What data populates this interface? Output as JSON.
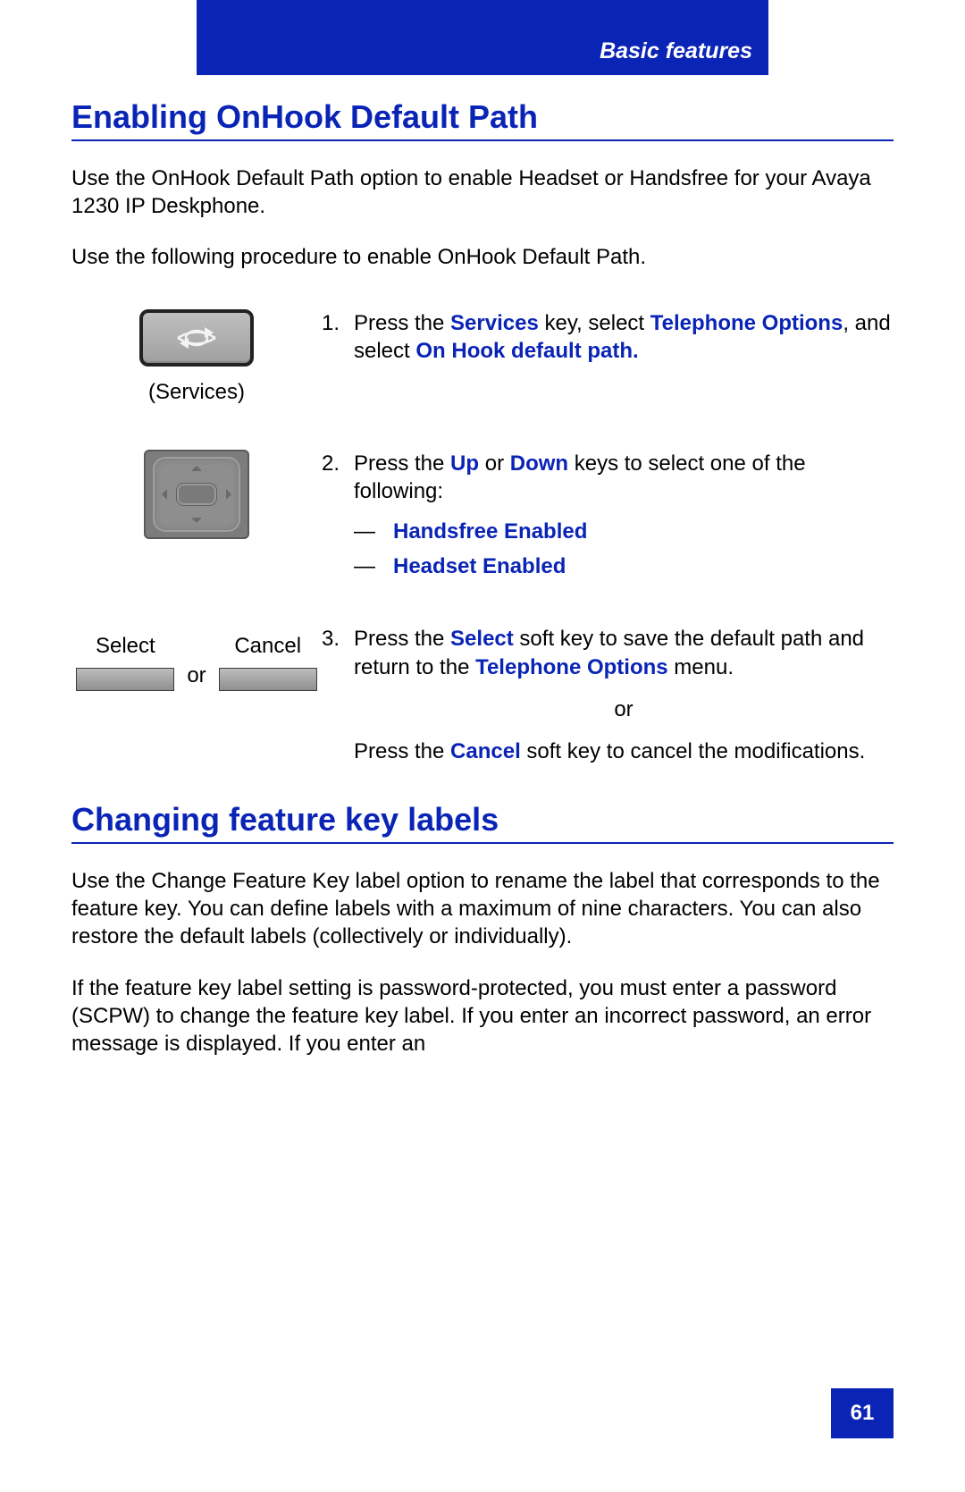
{
  "header": {
    "section_label": "Basic features"
  },
  "section1": {
    "title": "Enabling OnHook Default Path",
    "intro1": "Use the OnHook Default Path option to enable Headset or Handsfree for your Avaya 1230 IP Deskphone.",
    "intro2": "Use the following procedure to enable OnHook Default Path."
  },
  "steps": {
    "s1": {
      "num": "1.",
      "caption": "(Services)",
      "t1": "Press the ",
      "kw1": "Services",
      "t2": " key, select ",
      "kw2": "Telephone Options",
      "t3": ", and select ",
      "kw3": "On Hook default path."
    },
    "s2": {
      "num": "2.",
      "t1": "Press the ",
      "kw1": "Up",
      "t2": " or ",
      "kw2": "Down",
      "t3": " keys to select one of the following:",
      "dash": "—",
      "opt1": "Handsfree Enabled",
      "opt2": "Headset Enabled"
    },
    "s3": {
      "num": "3.",
      "left": {
        "select": "Select",
        "cancel": "Cancel",
        "or": "or"
      },
      "t1": "Press the ",
      "kw1": "Select",
      "t2": " soft key to save the default path and return to the ",
      "kw2": "Telephone Options",
      "t3": " menu.",
      "or": "or",
      "t4": "Press the ",
      "kw3": "Cancel",
      "t5": " soft key to cancel the modifications."
    }
  },
  "section2": {
    "title": "Changing feature key labels",
    "p1": "Use the Change Feature Key label option to rename the label that corresponds to the feature key. You can define labels with a maximum of nine characters. You can also restore the default labels (collectively or individually).",
    "p2": "If the feature key label setting is password-protected, you must enter a password (SCPW) to change the feature key label. If you enter an incorrect password, an error message is displayed. If you enter an"
  },
  "page_number": "61"
}
